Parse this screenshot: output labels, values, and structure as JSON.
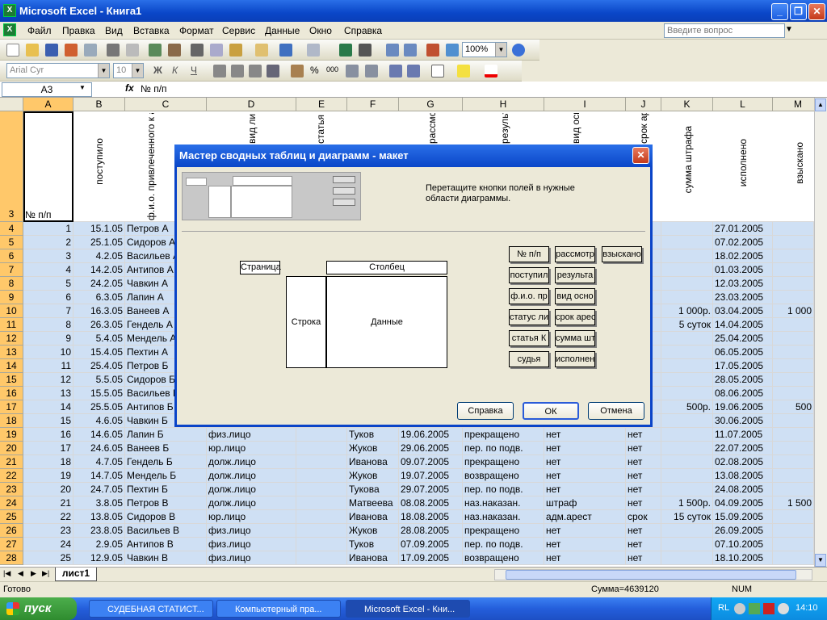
{
  "window": {
    "title": "Microsoft Excel - Книга1",
    "min": "_",
    "max": "❐",
    "close": "✕"
  },
  "menu": {
    "items": [
      "Файл",
      "Правка",
      "Вид",
      "Вставка",
      "Формат",
      "Сервис",
      "Данные",
      "Окно",
      "Справка"
    ],
    "help_placeholder": "Введите вопрос"
  },
  "toolbar": {
    "zoom": "100%",
    "font": "Arial Cyr",
    "size": "10",
    "bold": "Ж",
    "italic": "К",
    "underline": "Ч",
    "percent": "%",
    "thousands": "000",
    "inc_decimals": ",00→,0",
    "dec_decimals": ",00→,0"
  },
  "formula": {
    "cell": "A3",
    "fx": "fx",
    "content": "№ п/п"
  },
  "columns": [
    "A",
    "B",
    "C",
    "D",
    "E",
    "F",
    "G",
    "H",
    "I",
    "J",
    "K",
    "L",
    "M"
  ],
  "header_row": {
    "row": "3",
    "a": "№ п/п",
    "b": "поступило",
    "c": "ф.и.о. привлеченного к административной ответственности",
    "d": "вид лица",
    "e": "статья КоАП",
    "f": "судья",
    "g": "рассмотрено",
    "h": "результат рассмотрения",
    "i": "вид основного наказания",
    "j": "срок ареста",
    "k": "сумма штрафа",
    "l": "исполнено",
    "m": "взыскано"
  },
  "rows": [
    {
      "r": "4",
      "a": "1",
      "b": "15.1.05",
      "c": "Петров А",
      "d": "",
      "f": "",
      "g": "",
      "h": "",
      "i": "",
      "j": "",
      "k": "",
      "l": "27.01.2005",
      "m": ""
    },
    {
      "r": "5",
      "a": "2",
      "b": "25.1.05",
      "c": "Сидоров А",
      "d": "",
      "f": "",
      "g": "",
      "h": "",
      "i": "",
      "j": "",
      "k": "",
      "l": "07.02.2005",
      "m": ""
    },
    {
      "r": "6",
      "a": "3",
      "b": "4.2.05",
      "c": "Васильев А",
      "d": "",
      "f": "",
      "g": "",
      "h": "",
      "i": "",
      "j": "",
      "k": "",
      "l": "18.02.2005",
      "m": ""
    },
    {
      "r": "7",
      "a": "4",
      "b": "14.2.05",
      "c": "Антипов А",
      "d": "",
      "f": "",
      "g": "",
      "h": "",
      "i": "",
      "j": "",
      "k": "",
      "l": "01.03.2005",
      "m": ""
    },
    {
      "r": "8",
      "a": "5",
      "b": "24.2.05",
      "c": "Чавкин А",
      "d": "",
      "f": "",
      "g": "",
      "h": "",
      "i": "",
      "j": "",
      "k": "",
      "l": "12.03.2005",
      "m": ""
    },
    {
      "r": "9",
      "a": "6",
      "b": "6.3.05",
      "c": "Лапин А",
      "d": "",
      "f": "",
      "g": "",
      "h": "",
      "i": "",
      "j": "",
      "k": "",
      "l": "23.03.2005",
      "m": ""
    },
    {
      "r": "10",
      "a": "7",
      "b": "16.3.05",
      "c": "Ванеев А",
      "d": "",
      "f": "",
      "g": "",
      "h": "",
      "i": "",
      "j": "",
      "k": "1 000р.",
      "l": "03.04.2005",
      "m": "1 000"
    },
    {
      "r": "11",
      "a": "8",
      "b": "26.3.05",
      "c": "Гендель А",
      "d": "",
      "f": "",
      "g": "",
      "h": "",
      "i": "",
      "j": "",
      "k": "5 суток",
      "l": "14.04.2005",
      "m": ""
    },
    {
      "r": "12",
      "a": "9",
      "b": "5.4.05",
      "c": "Мендель А",
      "d": "",
      "f": "",
      "g": "",
      "h": "",
      "i": "",
      "j": "",
      "k": "",
      "l": "25.04.2005",
      "m": ""
    },
    {
      "r": "13",
      "a": "10",
      "b": "15.4.05",
      "c": "Пехтин А",
      "d": "",
      "f": "",
      "g": "",
      "h": "",
      "i": "",
      "j": "",
      "k": "",
      "l": "06.05.2005",
      "m": ""
    },
    {
      "r": "14",
      "a": "11",
      "b": "25.4.05",
      "c": "Петров Б",
      "d": "",
      "f": "",
      "g": "",
      "h": "",
      "i": "",
      "j": "",
      "k": "",
      "l": "17.05.2005",
      "m": ""
    },
    {
      "r": "15",
      "a": "12",
      "b": "5.5.05",
      "c": "Сидоров Б",
      "d": "",
      "f": "",
      "g": "",
      "h": "",
      "i": "",
      "j": "",
      "k": "",
      "l": "28.05.2005",
      "m": ""
    },
    {
      "r": "16",
      "a": "13",
      "b": "15.5.05",
      "c": "Васильев Б",
      "d": "",
      "f": "",
      "g": "",
      "h": "",
      "i": "",
      "j": "",
      "k": "",
      "l": "08.06.2005",
      "m": ""
    },
    {
      "r": "17",
      "a": "14",
      "b": "25.5.05",
      "c": "Антипов Б",
      "d": "",
      "f": "",
      "g": "",
      "h": "",
      "i": "",
      "j": "",
      "k": "500р.",
      "l": "19.06.2005",
      "m": "500"
    },
    {
      "r": "18",
      "a": "15",
      "b": "4.6.05",
      "c": "Чавкин Б",
      "d": "",
      "f": "",
      "g": "",
      "h": "",
      "i": "",
      "j": "",
      "k": "",
      "l": "30.06.2005",
      "m": ""
    },
    {
      "r": "19",
      "a": "16",
      "b": "14.6.05",
      "c": "Лапин Б",
      "d": "физ.лицо",
      "f": "Туков",
      "g": "19.06.2005",
      "h": "прекращено",
      "i": "нет",
      "j": "нет",
      "k": "",
      "l": "11.07.2005",
      "m": ""
    },
    {
      "r": "20",
      "a": "17",
      "b": "24.6.05",
      "c": "Ванеев Б",
      "d": "юр.лицо",
      "f": "Жуков",
      "g": "29.06.2005",
      "h": "пер. по подв.",
      "i": "нет",
      "j": "нет",
      "k": "",
      "l": "22.07.2005",
      "m": ""
    },
    {
      "r": "21",
      "a": "18",
      "b": "4.7.05",
      "c": "Гендель Б",
      "d": "долж.лицо",
      "f": "Иванова",
      "g": "09.07.2005",
      "h": "прекращено",
      "i": "нет",
      "j": "нет",
      "k": "",
      "l": "02.08.2005",
      "m": ""
    },
    {
      "r": "22",
      "a": "19",
      "b": "14.7.05",
      "c": "Мендель Б",
      "d": "долж.лицо",
      "f": "Жуков",
      "g": "19.07.2005",
      "h": "возвращено",
      "i": "нет",
      "j": "нет",
      "k": "",
      "l": "13.08.2005",
      "m": ""
    },
    {
      "r": "23",
      "a": "20",
      "b": "24.7.05",
      "c": "Пехтин Б",
      "d": "долж.лицо",
      "f": "Тукова",
      "g": "29.07.2005",
      "h": "пер. по подв.",
      "i": "нет",
      "j": "нет",
      "k": "",
      "l": "24.08.2005",
      "m": ""
    },
    {
      "r": "24",
      "a": "21",
      "b": "3.8.05",
      "c": "Петров В",
      "d": "долж.лицо",
      "f": "Матвеева",
      "g": "08.08.2005",
      "h": "наз.наказан.",
      "i": "штраф",
      "j": "нет",
      "k": "1 500р.",
      "l": "04.09.2005",
      "m": "1 500"
    },
    {
      "r": "25",
      "a": "22",
      "b": "13.8.05",
      "c": "Сидоров В",
      "d": "юр.лицо",
      "f": "Иванова",
      "g": "18.08.2005",
      "h": "наз.наказан.",
      "i": "адм.арест",
      "j": "срок",
      "k": "15 суток",
      "l": "15.09.2005",
      "m": ""
    },
    {
      "r": "26",
      "a": "23",
      "b": "23.8.05",
      "c": "Васильев В",
      "d": "физ.лицо",
      "f": "Жуков",
      "g": "28.08.2005",
      "h": "прекращено",
      "i": "нет",
      "j": "нет",
      "k": "",
      "l": "26.09.2005",
      "m": ""
    },
    {
      "r": "27",
      "a": "24",
      "b": "2.9.05",
      "c": "Антипов В",
      "d": "физ.лицо",
      "f": "Туков",
      "g": "07.09.2005",
      "h": "пер. по подв.",
      "i": "нет",
      "j": "нет",
      "k": "",
      "l": "07.10.2005",
      "m": ""
    },
    {
      "r": "28",
      "a": "25",
      "b": "12.9.05",
      "c": "Чавкин В",
      "d": "физ.лицо",
      "f": "Иванова",
      "g": "17.09.2005",
      "h": "возвращено",
      "i": "нет",
      "j": "нет",
      "k": "",
      "l": "18.10.2005",
      "m": ""
    }
  ],
  "sheet": {
    "tab": "лист1",
    "nav": [
      "|◀",
      "◀",
      "▶",
      "▶|"
    ]
  },
  "status": {
    "ready": "Готово",
    "sum": "Сумма=4639120",
    "num": "NUM"
  },
  "taskbar": {
    "start": "пуск",
    "tasks": [
      "СУДЕБНАЯ СТАТИСТ...",
      "Компьютерный пра...",
      "Microsoft Excel - Кни..."
    ],
    "lang": "RL",
    "time": "14:10"
  },
  "dialog": {
    "title": "Мастер сводных таблиц и диаграмм - макет",
    "instruction": "Перетащите кнопки полей в нужные области диаграммы.",
    "page": "Страница",
    "column": "Столбец",
    "row": "Строка",
    "data": "Данные",
    "fields": [
      "№ п/п",
      "рассмотр",
      "взыскано",
      "поступил",
      "результа",
      "ф.и.о. пр",
      "вид осно",
      "статус ли",
      "срок арес",
      "статья К",
      "сумма шт",
      "судья",
      "исполнен"
    ],
    "buttons": {
      "help": "Справка",
      "ok": "ОК",
      "cancel": "Отмена"
    }
  }
}
